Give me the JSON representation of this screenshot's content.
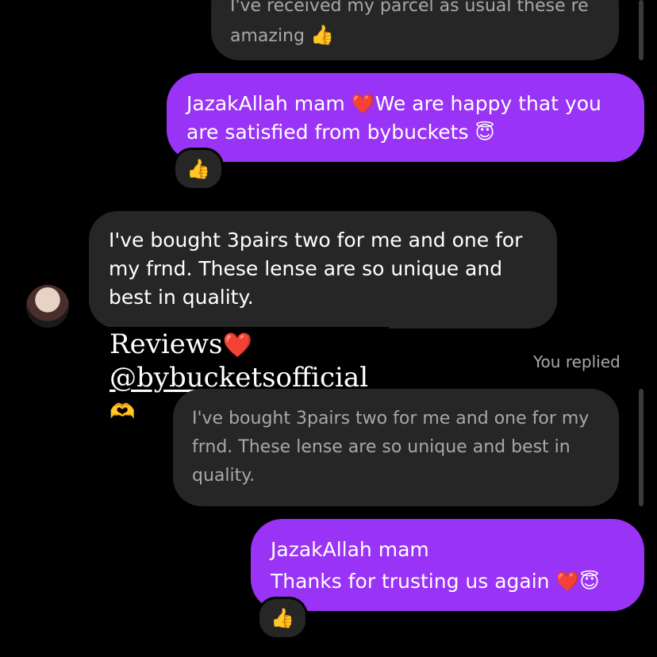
{
  "messages": {
    "top_quoted": {
      "line1": "I've received my parcel as usual these re",
      "line2": "amazing",
      "emoji": "👍"
    },
    "reply1": {
      "line1_a": "JazakAllah mam ",
      "heart": "❤️",
      "line1_b": "We are happy that you",
      "line2": "are satisfied from bybuckets ",
      "emoji": "😇",
      "reaction": "👍"
    },
    "customer": {
      "line1": "I've bought 3pairs two for me and one for",
      "line2": "my frnd. These lense are so unique and",
      "line3": "best in quality."
    },
    "story_sticker": {
      "line1": "Reviews",
      "heart": "❤️",
      "handle": "@bybucketsofficial",
      "hands": "🫶"
    },
    "you_replied_label": "You replied",
    "quoted_reply": {
      "line1": "I've bought 3pairs two for me and one for my",
      "line2": "frnd. These lense are so unique and best in",
      "line3": "quality."
    },
    "reply2": {
      "line1": "JazakAllah mam",
      "line2": "Thanks for trusting us again ",
      "heart": "❤️",
      "emoji": "😇",
      "reaction": "👍"
    }
  },
  "colors": {
    "background": "#000000",
    "outgoing_bubble": "#9933f5",
    "incoming_bubble": "#262626",
    "muted_text": "#a8a8a8"
  }
}
